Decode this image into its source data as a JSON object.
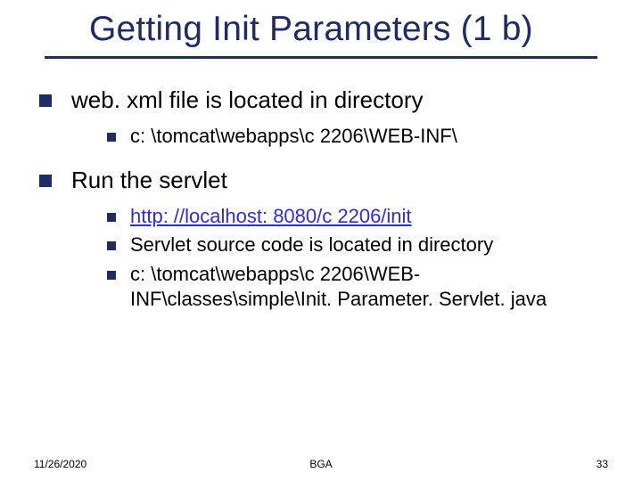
{
  "title": "Getting Init Parameters (1 b)",
  "bullets": {
    "b1": {
      "text": "web. xml file is located in directory",
      "sub": {
        "s1": "c: \\tomcat\\webapps\\c 2206\\WEB-INF\\"
      }
    },
    "b2": {
      "text": "Run the servlet",
      "sub": {
        "s1_link": "http: //localhost: 8080/c 2206/init",
        "s2": "Servlet source code is located in directory",
        "s3": "c: \\tomcat\\webapps\\c 2206\\WEB-INF\\classes\\simple\\Init. Parameter. Servlet. java"
      }
    }
  },
  "footer": {
    "date": "11/26/2020",
    "center": "BGA",
    "page": "33"
  }
}
